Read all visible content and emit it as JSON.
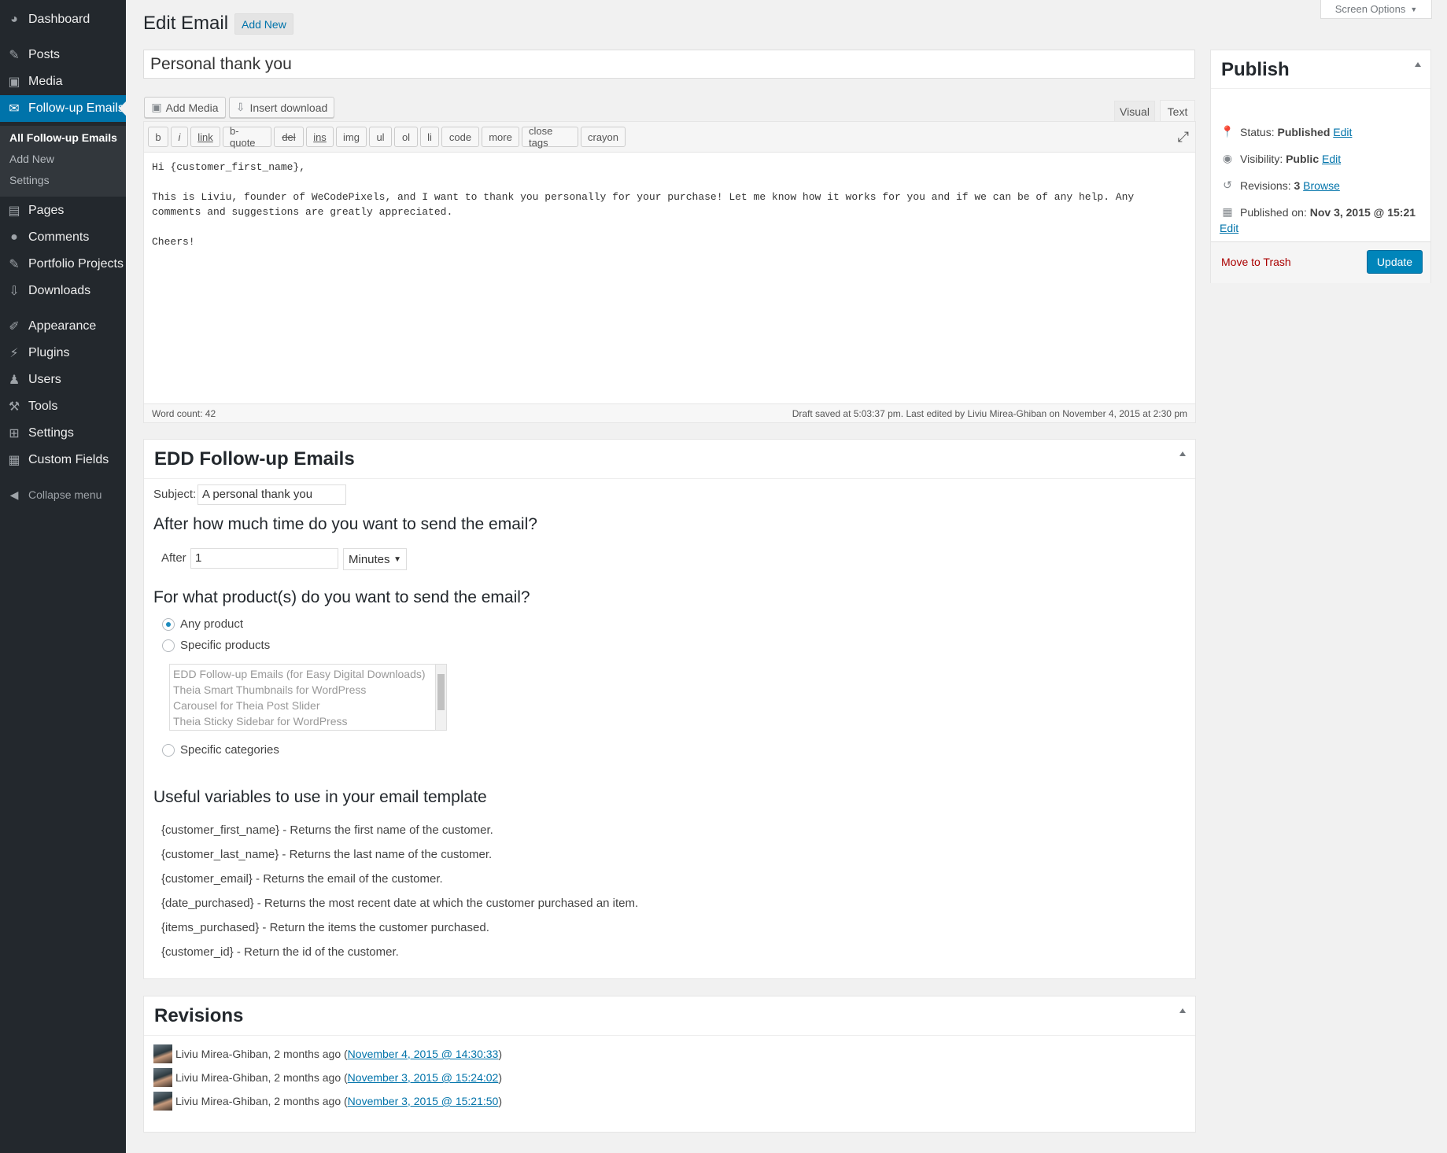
{
  "screen_options": "Screen Options",
  "menu": {
    "dashboard": "Dashboard",
    "posts": "Posts",
    "media": "Media",
    "followup": "Follow-up Emails",
    "sub_all": "All Follow-up Emails",
    "sub_add": "Add New",
    "sub_settings": "Settings",
    "pages": "Pages",
    "comments": "Comments",
    "portfolio": "Portfolio Projects",
    "downloads": "Downloads",
    "appearance": "Appearance",
    "plugins": "Plugins",
    "users": "Users",
    "tools": "Tools",
    "settings": "Settings",
    "custom_fields": "Custom Fields",
    "collapse": "Collapse menu"
  },
  "page": {
    "title": "Edit Email",
    "add_new": "Add New",
    "post_title": "Personal thank you"
  },
  "editor": {
    "add_media": "Add Media",
    "insert_download": "Insert download",
    "tab_visual": "Visual",
    "tab_text": "Text",
    "quicktags": [
      "b",
      "i",
      "link",
      "b-quote",
      "del",
      "ins",
      "img",
      "ul",
      "ol",
      "li",
      "code",
      "more",
      "close tags",
      "crayon"
    ],
    "line1": "Hi {customer_first_name},",
    "line2": "This is Liviu, founder of WeCodePixels, and I want to thank you personally for your purchase! Let me know how it works for you and if we can be of any help. Any",
    "line3": "comments and suggestions are greatly appreciated.",
    "line4": "Cheers!",
    "word_count": "Word count: 42",
    "draft_status": "Draft saved at 5:03:37 pm. Last edited by Liviu Mirea-Ghiban on November 4, 2015 at 2:30 pm"
  },
  "publish": {
    "title": "Publish",
    "status_label": "Status:",
    "status_value": "Published",
    "visibility_label": "Visibility:",
    "visibility_value": "Public",
    "revisions_label": "Revisions:",
    "revisions_value": "3",
    "browse": "Browse",
    "published_label": "Published on:",
    "published_value": "Nov 3, 2015 @ 15:21",
    "edit": "Edit",
    "trash": "Move to Trash",
    "update": "Update"
  },
  "edd": {
    "title": "EDD Follow-up Emails",
    "subject_label": "Subject:",
    "subject_value": "A personal thank you",
    "time_question": "After how much time do you want to send the email?",
    "after_label": "After",
    "after_value": "1",
    "unit": "Minutes",
    "product_question": "For what product(s) do you want to send the email?",
    "any_product": "Any product",
    "specific_products": "Specific products",
    "products": [
      "EDD Follow-up Emails (for Easy Digital Downloads)",
      "Theia Smart Thumbnails for WordPress",
      "Carousel for Theia Post Slider",
      "Theia Sticky Sidebar for WordPress"
    ],
    "specific_categories": "Specific categories",
    "vars_heading": "Useful variables to use in your email template",
    "vars": [
      "{customer_first_name} - Returns the first name of the customer.",
      "{customer_last_name} - Returns the last name of the customer.",
      "{customer_email} - Returns the email of the customer.",
      "{date_purchased} - Returns the most recent date at which the customer purchased an item.",
      "{items_purchased} - Return the items the customer purchased.",
      "{customer_id} - Return the id of the customer."
    ]
  },
  "revisions": {
    "title": "Revisions",
    "items": [
      {
        "author": "Liviu Mirea-Ghiban, 2 months ago (",
        "date": "November 4, 2015 @ 14:30:33",
        "close": ")"
      },
      {
        "author": "Liviu Mirea-Ghiban, 2 months ago (",
        "date": "November 3, 2015 @ 15:24:02",
        "close": ")"
      },
      {
        "author": "Liviu Mirea-Ghiban, 2 months ago (",
        "date": "November 3, 2015 @ 15:21:50",
        "close": ")"
      }
    ]
  },
  "colors": {
    "accent": "#0073aa",
    "menu_bg": "#23282d",
    "submenu_bg": "#32373c",
    "update_btn": "#0085ba",
    "trash": "#a00"
  }
}
